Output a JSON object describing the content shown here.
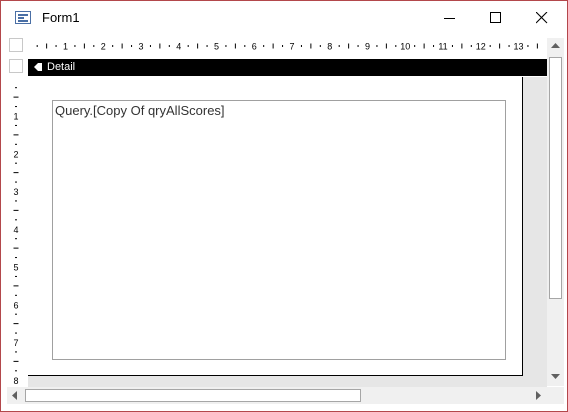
{
  "window": {
    "title": "Form1",
    "icon": "form-icon",
    "controls": [
      "minimize-icon",
      "maximize-icon",
      "close-icon"
    ]
  },
  "ruler": {
    "horizontal_numbers": [
      "1",
      "2",
      "3",
      "4",
      "5",
      "6",
      "7",
      "8",
      "9",
      "10",
      "11",
      "12",
      "13"
    ],
    "vertical_numbers": [
      "1",
      "2",
      "3",
      "4",
      "5",
      "6",
      "7",
      "8"
    ]
  },
  "section": {
    "label": "Detail",
    "icon": "section-arrow-icon"
  },
  "control": {
    "text": "Query.[Copy Of qryAllScores]"
  },
  "colors": {
    "section_header": "#000000",
    "window_border": "#b3474b",
    "grey_area": "#e6e6e6"
  }
}
